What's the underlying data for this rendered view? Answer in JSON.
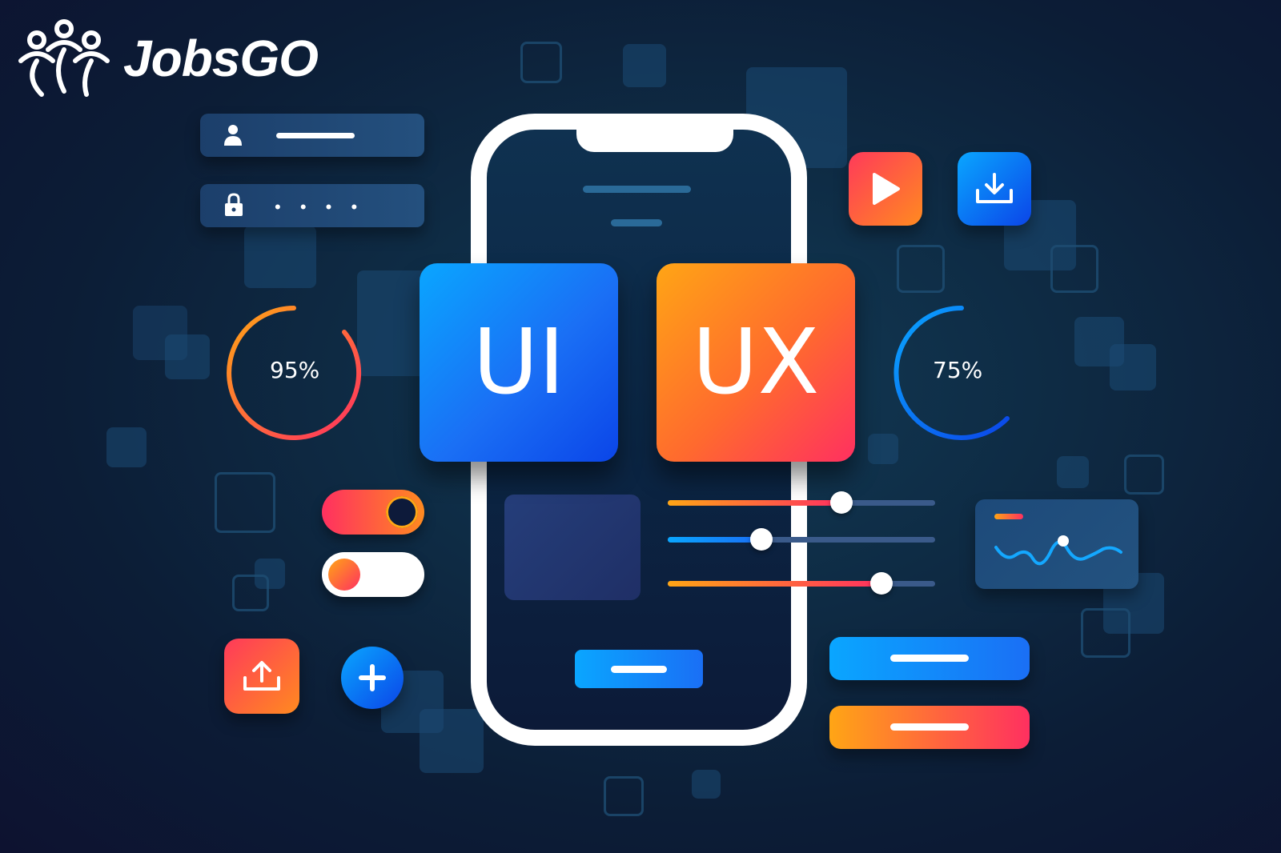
{
  "brand": {
    "name": "JobsGO"
  },
  "gauges": [
    {
      "label": "95%",
      "value": 95
    },
    {
      "label": "75%",
      "value": 75
    }
  ],
  "cards": {
    "ui": "UI",
    "ux": "UX"
  },
  "login": {
    "password_mask": "• • • •"
  },
  "sliders": [
    {
      "value": 0.65
    },
    {
      "value": 0.35
    },
    {
      "value": 0.8
    }
  ],
  "toggles": [
    {
      "state": "on"
    },
    {
      "state": "off"
    }
  ],
  "icons": [
    "user-icon",
    "lock-icon",
    "play-icon",
    "download-icon",
    "upload-icon",
    "plus-icon",
    "wave-chart-icon"
  ],
  "colors": {
    "blue_start": "#0aa6ff",
    "blue_end": "#0b45e8",
    "orange_start": "#ffa515",
    "orange_end": "#ff3060",
    "background": "#0e2b44"
  }
}
